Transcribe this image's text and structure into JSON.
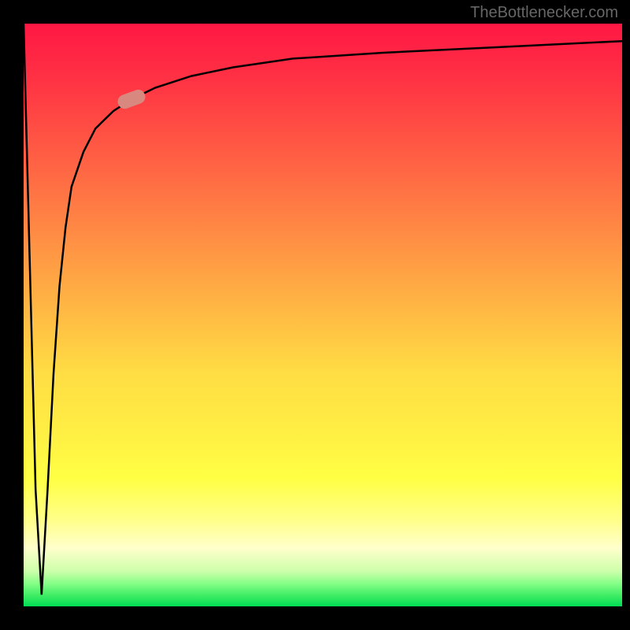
{
  "watermark": "TheBottlenecker.com",
  "chart_data": {
    "type": "line",
    "title": "",
    "xlabel": "",
    "ylabel": "",
    "xlim": [
      0,
      100
    ],
    "ylim": [
      0,
      100
    ],
    "series": [
      {
        "name": "bottleneck-curve",
        "description": "Performance bottleneck curve - starts at top-left, drops sharply to bottom (low bottleneck zone), then rises steeply and asymptotically approaches top",
        "x": [
          0,
          1,
          2,
          3,
          4,
          5,
          6,
          7,
          8,
          10,
          12,
          15,
          18,
          22,
          28,
          35,
          45,
          60,
          80,
          100
        ],
        "y": [
          100,
          60,
          20,
          2,
          20,
          40,
          55,
          65,
          72,
          78,
          82,
          85,
          87,
          89,
          91,
          92.5,
          94,
          95,
          96,
          97
        ]
      }
    ],
    "annotations": [
      {
        "name": "salmon-marker",
        "type": "marker",
        "x": 18,
        "y": 87,
        "color": "#d98880"
      }
    ],
    "background_gradient": {
      "type": "vertical",
      "description": "Red (top/high bottleneck) to Green (bottom/low bottleneck)",
      "stops": [
        {
          "pos": 0,
          "color": "#ff1744"
        },
        {
          "pos": 50,
          "color": "#ffbb44"
        },
        {
          "pos": 80,
          "color": "#ffff44"
        },
        {
          "pos": 100,
          "color": "#00dd55"
        }
      ]
    }
  }
}
